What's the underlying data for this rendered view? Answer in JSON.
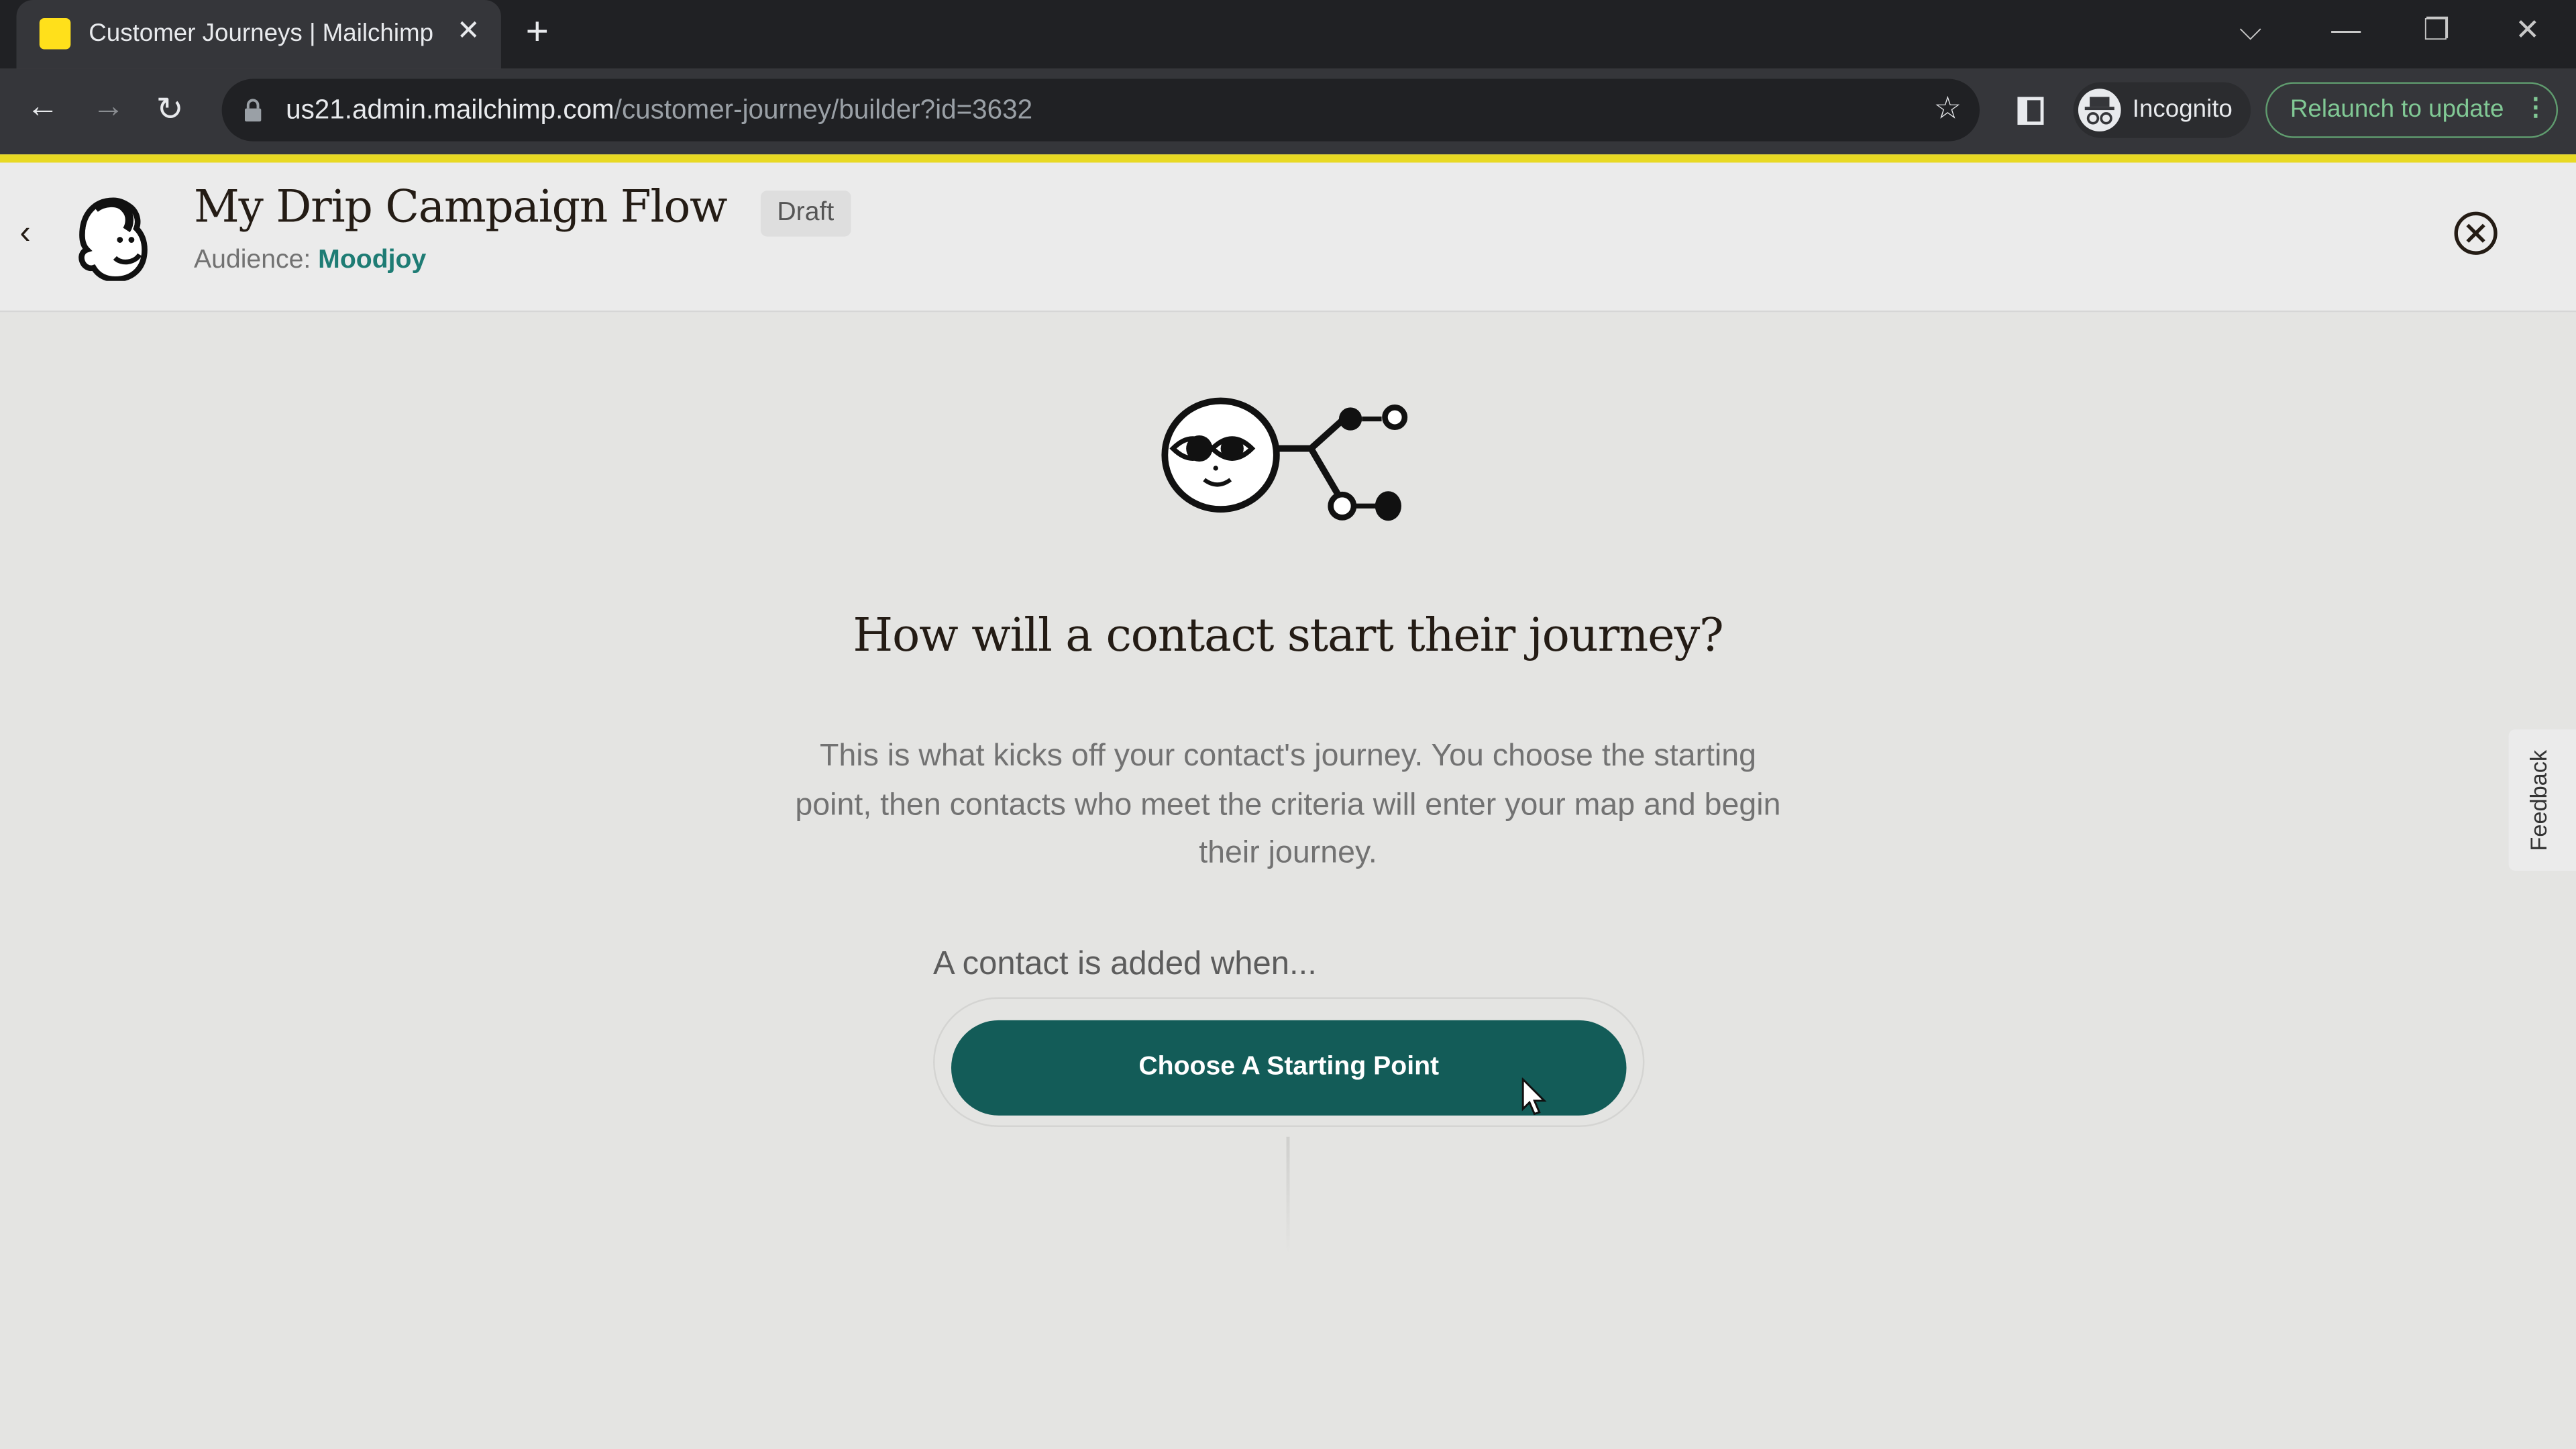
{
  "browser": {
    "tab_title": "Customer Journeys | Mailchimp",
    "url_host": "us21.admin.mailchimp.com",
    "url_path": "/customer-journey/builder?id=3632",
    "incognito_label": "Incognito",
    "relaunch_label": "Relaunch to update"
  },
  "header": {
    "title": "My Drip Campaign Flow",
    "status": "Draft",
    "audience_label": "Audience:",
    "audience_name": "Moodjoy"
  },
  "main": {
    "heading": "How will a contact start their journey?",
    "description": "This is what kicks off your contact's journey. You choose the starting point, then contacts who meet the criteria will enter your map and begin their journey.",
    "trigger_label": "A contact is added when...",
    "start_button": "Choose A Starting Point"
  },
  "feedback_label": "Feedback",
  "colors": {
    "accent": "#135c58",
    "brand_yellow": "#ffe01b",
    "link": "#1e7c74"
  }
}
